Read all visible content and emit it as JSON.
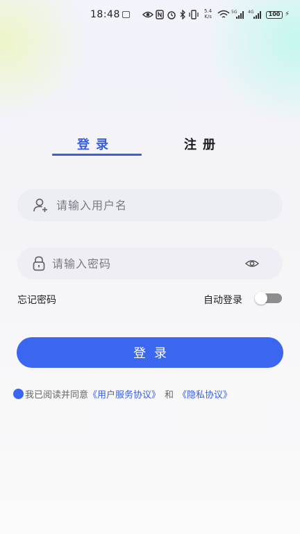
{
  "status_bar": {
    "time": "18:48",
    "net_speed_value": "5.4",
    "net_speed_unit": "K/s",
    "battery": "100",
    "signal1_label": "5G",
    "signal2_label": "4G"
  },
  "tabs": [
    {
      "label": "登录",
      "active": true
    },
    {
      "label": "注册",
      "active": false
    }
  ],
  "username": {
    "placeholder": "请输入用户名",
    "value": ""
  },
  "password": {
    "placeholder": "请输入密码",
    "value": ""
  },
  "forgot_password": "忘记密码",
  "auto_login": {
    "label": "自动登录",
    "enabled": false
  },
  "login_button": "登录",
  "agreement": {
    "prefix": "我已阅读并同意",
    "user_agreement": "《用户服务协议》",
    "and": "和",
    "privacy": "《隐私协议》"
  },
  "colors": {
    "accent": "#3a66f0",
    "tab_active": "#3a5fd8"
  }
}
